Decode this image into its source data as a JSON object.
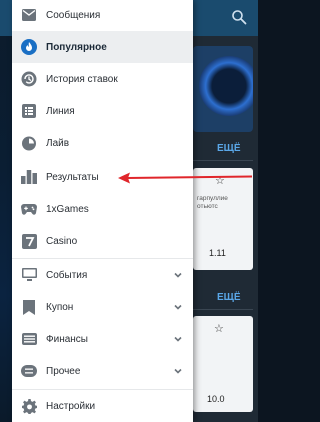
{
  "background": {
    "more_label_1": "ЕЩЁ",
    "more_label_2": "ЕЩЁ",
    "card1_text": "гарпуллие\nотьютс",
    "card1_value": "1.11",
    "card2_text": "",
    "card2_value": "10.0"
  },
  "menu": {
    "items": [
      {
        "label": "Сообщения",
        "icon": "envelope-icon",
        "active": false
      },
      {
        "label": "Популярное",
        "icon": "fire-icon",
        "active": true
      },
      {
        "label": "История ставок",
        "icon": "history-icon",
        "active": false
      },
      {
        "label": "Линия",
        "icon": "grid-icon",
        "active": false
      },
      {
        "label": "Лайв",
        "icon": "stopwatch-icon",
        "active": false
      },
      {
        "label": "Результаты",
        "icon": "podium-icon",
        "active": false
      },
      {
        "label": "1xGames",
        "icon": "gamepad-icon",
        "active": false
      },
      {
        "label": "Casino",
        "icon": "slot-icon",
        "active": false
      },
      {
        "label": "События",
        "icon": "monitor-icon",
        "active": false,
        "expandable": true
      },
      {
        "label": "Купон",
        "icon": "bookmark-icon",
        "active": false,
        "expandable": true
      },
      {
        "label": "Финансы",
        "icon": "wallet-icon",
        "active": false,
        "expandable": true
      },
      {
        "label": "Прочее",
        "icon": "more-icon",
        "active": false,
        "expandable": true
      },
      {
        "label": "Настройки",
        "icon": "gear-icon",
        "active": false
      }
    ]
  },
  "colors": {
    "accent_blue": "#1a6fc4",
    "icon_gray": "#6b737b",
    "arrow_red": "#e0262b",
    "drawer_bg": "#ffffff",
    "active_bg": "#eceef0"
  }
}
